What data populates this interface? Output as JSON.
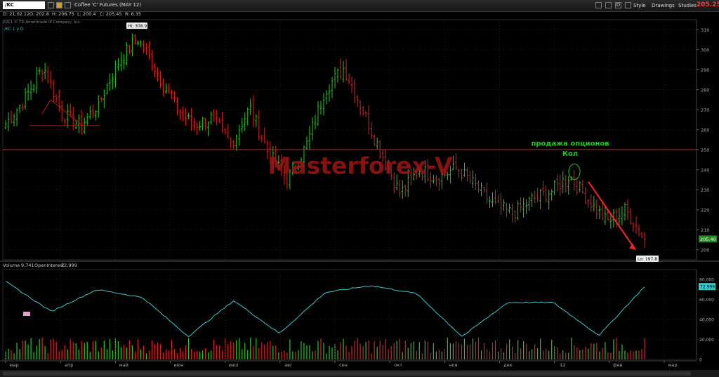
{
  "toolbar": {
    "symbol": "/KC",
    "title": "Coffee 'C' Futures (MAY 12)",
    "style_label": "Style",
    "drawings_label": "Drawings",
    "studies_label": "Studies",
    "last_price": "205.25",
    "d_label": "D"
  },
  "quote": {
    "date": "D: 21.02.12",
    "open": "O: 202.8",
    "high": "H: 206.75",
    "low": "L: 200.4",
    "close": "C: 205.45",
    "range": "R: 6.35"
  },
  "copyright": "2011 © TD Ameritrade IP Company, Inc.",
  "price_panel": {
    "label": "/KC 1 y D",
    "hi_label": "Hi: 308.9",
    "lo_label": "Lo: 197.8",
    "current_price_label": "205.40",
    "resistance_level": 250,
    "y_ticks": [
      200,
      210,
      220,
      230,
      240,
      250,
      260,
      270,
      280,
      290,
      300,
      310
    ],
    "watermark": "Masterforex-V",
    "annotation_line1": "продажа опционов",
    "annotation_line2": "Кол"
  },
  "volume_panel": {
    "label_volume": "Volume",
    "volume_value": "9,741",
    "label_oi": "OpenInterest",
    "oi_value": "72,999",
    "y_ticks": [
      "80,000",
      "60,000",
      "40,000",
      "20,000",
      "0"
    ],
    "oi_current_label": "72,999"
  },
  "x_axis": {
    "months": [
      "мар",
      "апр",
      "май",
      "июн",
      "июл",
      "авг",
      "сен",
      "окт",
      "ноя",
      "дек",
      "12",
      "фев",
      "мар"
    ]
  },
  "colors": {
    "up": "#28c828",
    "down": "#e02020",
    "oi_line": "#33cccc",
    "resistance": "#c01818",
    "annotation": "#1ec81e",
    "watermark": "#a01515"
  },
  "chart_data": {
    "type": "candlestick",
    "title": "Coffee 'C' Futures (MAY 12)",
    "ylim": [
      195,
      315
    ],
    "price_anchors": [
      {
        "month": "мар",
        "close": 263
      },
      {
        "month": "мар",
        "close": 275
      },
      {
        "month": "мар",
        "close": 292
      },
      {
        "month": "апр",
        "close": 268
      },
      {
        "month": "апр",
        "close": 262
      },
      {
        "month": "апр",
        "close": 274
      },
      {
        "month": "май",
        "close": 294
      },
      {
        "month": "май",
        "close": 306
      },
      {
        "month": "май",
        "close": 290
      },
      {
        "month": "июн",
        "close": 272
      },
      {
        "month": "июн",
        "close": 262
      },
      {
        "month": "июн",
        "close": 266
      },
      {
        "month": "июл",
        "close": 253
      },
      {
        "month": "июл",
        "close": 271
      },
      {
        "month": "авг",
        "close": 248
      },
      {
        "month": "авг",
        "close": 235
      },
      {
        "month": "авг",
        "close": 252
      },
      {
        "month": "сен",
        "close": 280
      },
      {
        "month": "сен",
        "close": 291
      },
      {
        "month": "сен",
        "close": 270
      },
      {
        "month": "окт",
        "close": 248
      },
      {
        "month": "окт",
        "close": 228
      },
      {
        "month": "окт",
        "close": 240
      },
      {
        "month": "ноя",
        "close": 236
      },
      {
        "month": "ноя",
        "close": 241
      },
      {
        "month": "ноя",
        "close": 232
      },
      {
        "month": "дек",
        "close": 222
      },
      {
        "month": "дек",
        "close": 218
      },
      {
        "month": "дек",
        "close": 225
      },
      {
        "month": "12",
        "close": 229
      },
      {
        "month": "12",
        "close": 237
      },
      {
        "month": "12",
        "close": 225
      },
      {
        "month": "фев",
        "close": 214
      },
      {
        "month": "фев",
        "close": 220
      },
      {
        "month": "фев",
        "close": 205
      }
    ],
    "open_interest_anchors": [
      {
        "month": "мар",
        "value": 78000
      },
      {
        "month": "апр",
        "value": 48000
      },
      {
        "month": "май",
        "value": 70000
      },
      {
        "month": "июн",
        "value": 62000
      },
      {
        "month": "июн",
        "value": 23000
      },
      {
        "month": "июл",
        "value": 59000
      },
      {
        "month": "авг",
        "value": 26000
      },
      {
        "month": "авг",
        "value": 67000
      },
      {
        "month": "сен",
        "value": 74000
      },
      {
        "month": "окт",
        "value": 66000
      },
      {
        "month": "ноя",
        "value": 23000
      },
      {
        "month": "ноя",
        "value": 57000
      },
      {
        "month": "12",
        "value": 57000
      },
      {
        "month": "фев",
        "value": 24000
      },
      {
        "month": "фев",
        "value": 72999
      }
    ]
  }
}
